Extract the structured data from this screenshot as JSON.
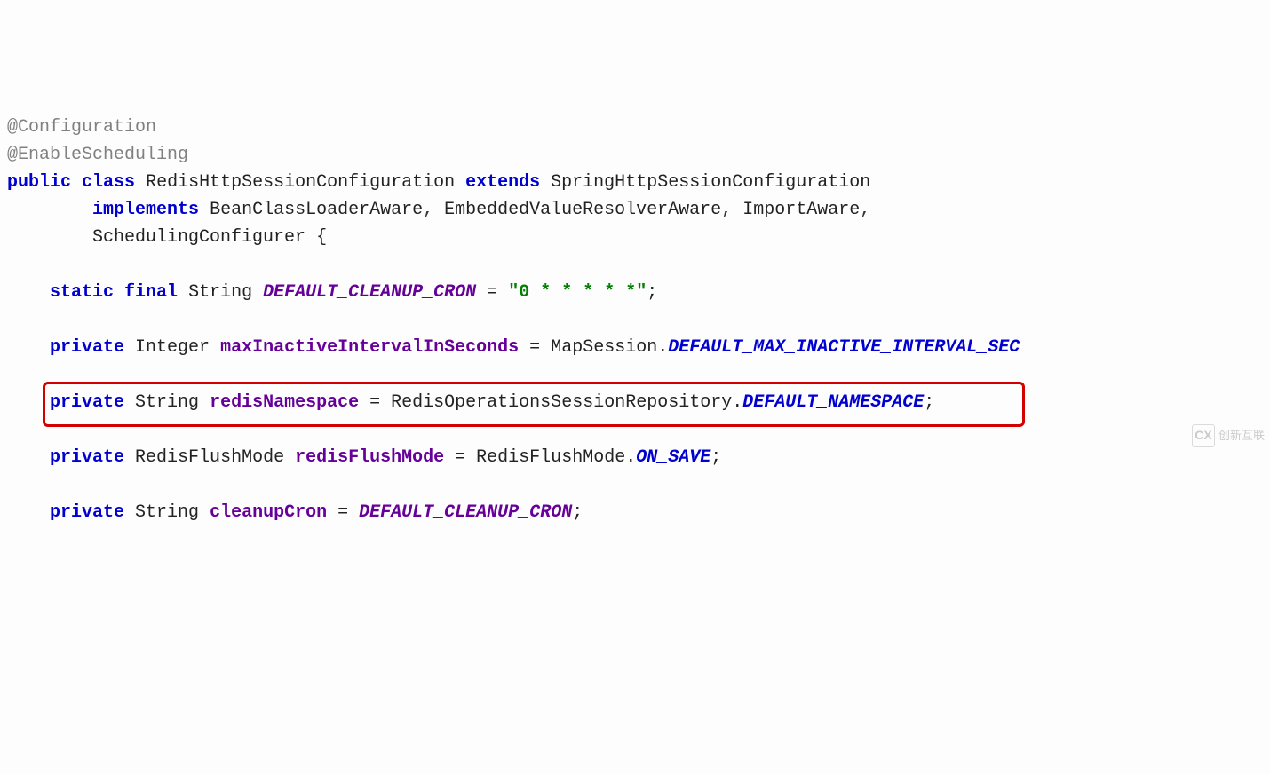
{
  "code": {
    "ann1": "@Configuration",
    "ann2": "@EnableScheduling",
    "kw_public": "public",
    "kw_class": "class",
    "className": "RedisHttpSessionConfiguration",
    "kw_extends": "extends",
    "superClass": "SpringHttpSessionConfiguration",
    "kw_implements": "implements",
    "iface1": "BeanClassLoaderAware",
    "iface2": "EmbeddedValueResolverAware",
    "iface3": "ImportAware",
    "iface4": "SchedulingConfigurer",
    "brace_open": "{",
    "kw_static": "static",
    "kw_final": "final",
    "t_string": "String",
    "f_DEFAULT_CLEANUP_CRON": "DEFAULT_CLEANUP_CRON",
    "eq": "=",
    "str_cron": "\"0 * * * * *\"",
    "semi": ";",
    "kw_private": "private",
    "t_integer": "Integer",
    "f_maxInactive": "maxInactiveIntervalInSeconds",
    "cls_MapSession": "MapSession",
    "dot": ".",
    "c_DEFAULT_MAX": "DEFAULT_MAX_INACTIVE_INTERVAL_SEC",
    "f_redisNamespace": "redisNamespace",
    "cls_RedisOpsRepo": "RedisOperationsSessionRepository",
    "c_DEFAULT_NAMESPACE": "DEFAULT_NAMESPACE",
    "t_RedisFlushMode": "RedisFlushMode",
    "f_redisFlushMode": "redisFlushMode",
    "cls_RedisFlushMode": "RedisFlushMode",
    "c_ON_SAVE": "ON_SAVE",
    "f_cleanupCron": "cleanupCron",
    "ref_DEFAULT_CLEANUP_CRON": "DEFAULT_CLEANUP_CRON"
  },
  "highlight": {
    "row_index": 10
  },
  "watermark": {
    "logo": "CX",
    "text": "创新互联"
  }
}
